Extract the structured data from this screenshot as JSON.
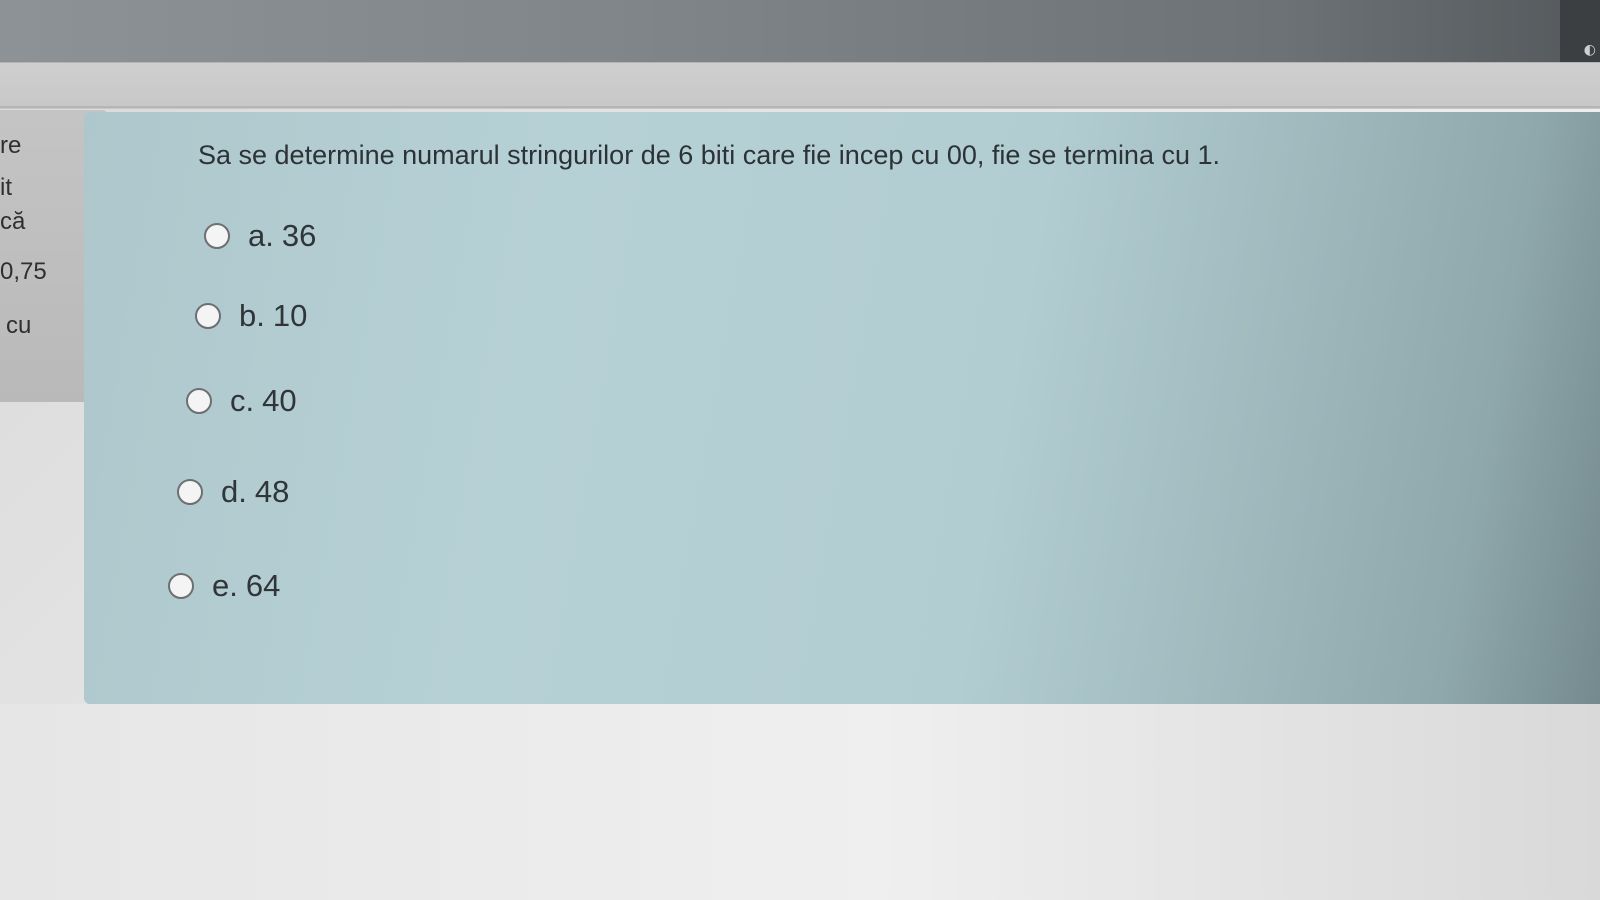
{
  "sidebar": {
    "lines": [
      "re",
      "it",
      "că",
      "0,75",
      "cu"
    ]
  },
  "question": {
    "text": "Sa se determine numarul stringurilor de 6 biti care fie incep cu 00, fie se termina cu 1.",
    "options": [
      {
        "letter": "a.",
        "value": "36"
      },
      {
        "letter": "b.",
        "value": "10"
      },
      {
        "letter": "c.",
        "value": "40"
      },
      {
        "letter": "d.",
        "value": "48"
      },
      {
        "letter": "e.",
        "value": "64"
      }
    ]
  },
  "colors": {
    "card": "#b2cdd2",
    "text": "#2c3336"
  }
}
